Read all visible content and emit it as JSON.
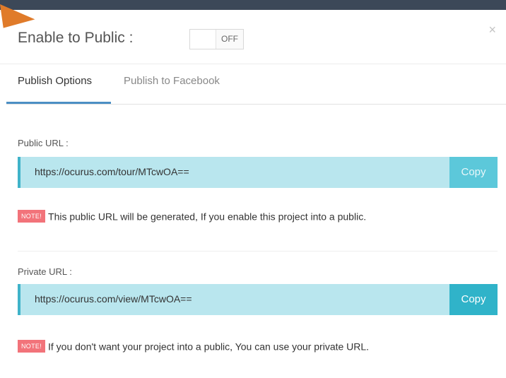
{
  "header": {
    "title": "Enable to Public :",
    "toggle_state": "OFF"
  },
  "tabs": [
    {
      "label": "Publish Options",
      "active": true
    },
    {
      "label": "Publish to Facebook",
      "active": false
    }
  ],
  "public": {
    "label": "Public URL :",
    "url": "https://ocurus.com/tour/MTcwOA==",
    "copy_label": "Copy",
    "note_badge": "NOTE!",
    "note_text": "This public URL will be generated, If you enable this project into a public."
  },
  "private": {
    "label": "Private URL :",
    "url": "https://ocurus.com/view/MTcwOA==",
    "copy_label": "Copy",
    "note_badge": "NOTE!",
    "note_text": "If you don't want your project into a public, You can use your private URL."
  },
  "colors": {
    "accent": "#4b8fc4",
    "url_box": "#b9e6ee",
    "copy_button": "#30b3c9",
    "note_badge": "#f2737a",
    "topbar": "#3c4858"
  }
}
